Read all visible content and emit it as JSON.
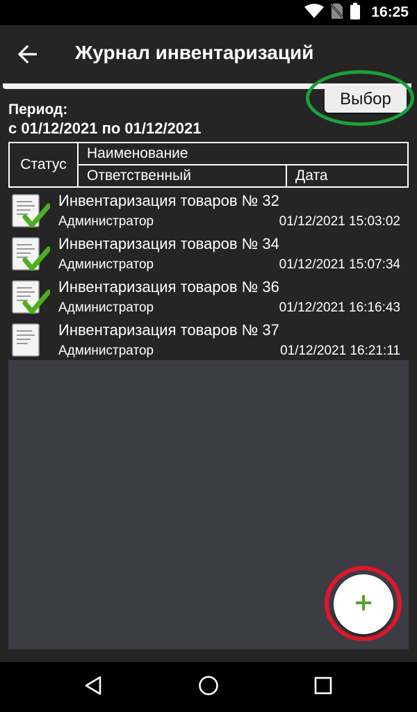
{
  "status_bar": {
    "time": "16:25",
    "icons": [
      "wifi-icon",
      "no-sim-icon",
      "battery-icon"
    ]
  },
  "app_bar": {
    "title": "Журнал инвентаризаций",
    "back_icon": "arrow-back-icon"
  },
  "select_button": {
    "label": "Выбор"
  },
  "period": {
    "label": "Период:",
    "value": "с 01/12/2021 по 01/12/2021"
  },
  "table_header": {
    "status": "Статус",
    "name": "Наименование",
    "responsible": "Ответственный",
    "date": "Дата"
  },
  "rows": [
    {
      "title": "Инвентаризация товаров № 32",
      "responsible": "Администратор",
      "date": "01/12/2021 15:03:02",
      "status_icon": "document-checked-icon"
    },
    {
      "title": "Инвентаризация товаров № 34",
      "responsible": "Администратор",
      "date": "01/12/2021 15:07:34",
      "status_icon": "document-checked-icon"
    },
    {
      "title": "Инвентаризация товаров № 36",
      "responsible": "Администратор",
      "date": "01/12/2021 16:16:43",
      "status_icon": "document-checked-icon"
    },
    {
      "title": "Инвентаризация товаров № 37",
      "responsible": "Администратор",
      "date": "01/12/2021 16:21:11",
      "status_icon": "document-icon"
    }
  ],
  "fab": {
    "label": "+",
    "icon": "plus-icon"
  },
  "nav_bar": {
    "icons": [
      "nav-back-icon",
      "nav-home-icon",
      "nav-recents-icon"
    ]
  },
  "colors": {
    "background": "#252525",
    "panel": "#3c3c44",
    "highlight_green": "#1e9e3a",
    "highlight_red": "#e0162b",
    "check_green": "#4caf1e",
    "plus_green": "#5aa02c"
  }
}
